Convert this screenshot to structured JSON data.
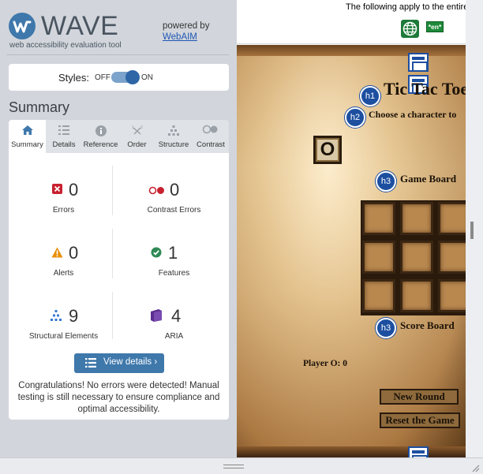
{
  "wave": {
    "logo_text": "WAVE",
    "tagline": "web accessibility evaluation tool",
    "powered_by": "powered by",
    "powered_link": "WebAIM",
    "styles_label": "Styles:",
    "styles_off": "OFF",
    "styles_on": "ON",
    "summary_heading": "Summary",
    "tabs": [
      {
        "label": "Summary",
        "icon": "home-icon"
      },
      {
        "label": "Details",
        "icon": "list-icon"
      },
      {
        "label": "Reference",
        "icon": "info-icon"
      },
      {
        "label": "Order",
        "icon": "order-icon"
      },
      {
        "label": "Structure",
        "icon": "structure-icon"
      },
      {
        "label": "Contrast",
        "icon": "contrast-icon"
      }
    ],
    "stats": {
      "errors": {
        "count": "0",
        "label": "Errors"
      },
      "contrast_errors": {
        "count": "0",
        "label": "Contrast Errors"
      },
      "alerts": {
        "count": "0",
        "label": "Alerts"
      },
      "features": {
        "count": "1",
        "label": "Features"
      },
      "structural": {
        "count": "9",
        "label": "Structural Elements"
      },
      "aria": {
        "count": "4",
        "label": "ARIA"
      }
    },
    "view_details": "View details ›",
    "congrats": "Congratulations! No errors were detected! Manual testing is still necessary to ensure compliance and optimal accessibility.",
    "colors": {
      "accent": "#3f78ab",
      "error": "#c8202f",
      "alert": "#e8900c",
      "feature": "#2f8a56",
      "structure": "#3a7ad0",
      "aria": "#5b2f8f"
    }
  },
  "preview": {
    "following_text": "The following apply to the entire",
    "lang_badge": "*en*",
    "title": "Tic Tac Toe",
    "choose_text": "Choose a character to",
    "o_button": "O",
    "game_board": "Game Board",
    "score_board": "Score Board",
    "player_score": "Player O: 0",
    "new_round": "New Round",
    "reset": "Reset the Game",
    "badges": [
      "h1",
      "h2",
      "h3",
      "h3"
    ]
  }
}
